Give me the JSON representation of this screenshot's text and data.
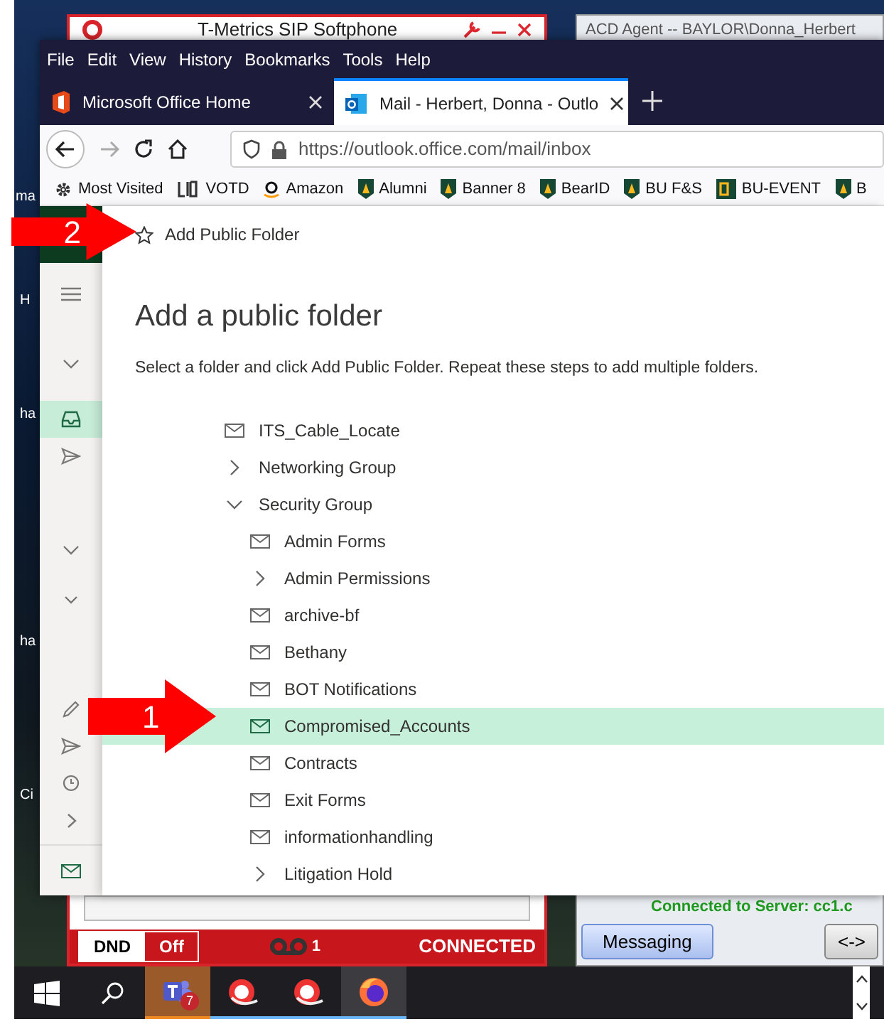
{
  "desktop": {
    "icon_labels": [
      "ma",
      "H",
      "ha",
      "ha",
      "Ci"
    ]
  },
  "softphone": {
    "title": "T-Metrics SIP Softphone",
    "dnd_label": "DND",
    "dnd_value": "Off",
    "dnd_on": false,
    "voicemail_count": "1",
    "status": "CONNECTED"
  },
  "acd_agent": {
    "title": "ACD Agent -- BAYLOR\\Donna_Herbert",
    "server_status": "Connected to Server: cc1.c",
    "buttons": [
      "Messaging",
      "<->"
    ]
  },
  "browser": {
    "menu": [
      "File",
      "Edit",
      "View",
      "History",
      "Bookmarks",
      "Tools",
      "Help"
    ],
    "tabs": [
      {
        "label": "Microsoft Office Home",
        "kind": "office",
        "selected": false
      },
      {
        "label": "Mail - Herbert, Donna - Outlo",
        "kind": "outlook",
        "selected": true
      }
    ],
    "url": "https://outlook.office.com/mail/inbox",
    "bookmarks": [
      {
        "label": "Most Visited",
        "kind": "gear"
      },
      {
        "label": "VOTD",
        "kind": "votd"
      },
      {
        "label": "Amazon",
        "kind": "amazon"
      },
      {
        "label": "Alumni",
        "kind": "bu"
      },
      {
        "label": "Banner 8",
        "kind": "bu"
      },
      {
        "label": "BearID",
        "kind": "bu"
      },
      {
        "label": "BU F&S",
        "kind": "bu"
      },
      {
        "label": "BU-EVENT",
        "kind": "bu-event"
      },
      {
        "label": "B",
        "kind": "bu"
      }
    ]
  },
  "outlook": {
    "rail": [
      [
        {
          "kind": "menu",
          "selected": false
        },
        {
          "kind": "chevron",
          "selected": false
        },
        {
          "kind": "inbox",
          "selected": true
        },
        {
          "kind": "send",
          "selected": false
        }
      ],
      [
        {
          "kind": "chevron",
          "selected": false
        },
        {
          "kind": "chevron-small",
          "selected": false
        }
      ],
      [
        {
          "kind": "pencil",
          "selected": false
        },
        {
          "kind": "send",
          "selected": false
        },
        {
          "kind": "clock",
          "selected": false
        },
        {
          "kind": "chevron-right",
          "selected": false
        },
        {
          "kind": "mail",
          "selected": false
        }
      ]
    ],
    "panel": {
      "header_action": "Add Public Folder",
      "title": "Add a public folder",
      "description": "Select a folder and click Add Public Folder. Repeat these steps to add multiple folders.",
      "folders": [
        {
          "label": "ITS_Cable_Locate",
          "kind": "folder",
          "selected": false
        },
        {
          "label": "Networking Group",
          "kind": "group",
          "expanded": false,
          "selected": false
        },
        {
          "label": "Security Group",
          "kind": "group",
          "expanded": true,
          "selected": false,
          "children": [
            {
              "label": "Admin Forms",
              "kind": "folder",
              "selected": false
            },
            {
              "label": "Admin Permissions",
              "kind": "group",
              "expanded": false,
              "selected": false
            },
            {
              "label": "archive-bf",
              "kind": "folder",
              "selected": false
            },
            {
              "label": "Bethany",
              "kind": "folder",
              "selected": false
            },
            {
              "label": "BOT Notifications",
              "kind": "folder",
              "selected": false
            },
            {
              "label": "Compromised_Accounts",
              "kind": "folder",
              "selected": true
            },
            {
              "label": "Contracts",
              "kind": "folder",
              "selected": false
            },
            {
              "label": "Exit Forms",
              "kind": "folder",
              "selected": false
            },
            {
              "label": "informationhandling",
              "kind": "folder",
              "selected": false
            },
            {
              "label": "Litigation Hold",
              "kind": "group",
              "expanded": false,
              "selected": false
            }
          ]
        }
      ]
    }
  },
  "annotations": [
    {
      "label": "2"
    },
    {
      "label": "1"
    }
  ],
  "taskbar": {
    "apps": [
      {
        "kind": "teams",
        "badge": "7",
        "flashing": true,
        "active": false
      },
      {
        "kind": "softphone",
        "flashing": false,
        "active": false
      },
      {
        "kind": "softphone",
        "flashing": false,
        "active": false
      },
      {
        "kind": "firefox",
        "flashing": false,
        "active": true
      }
    ]
  }
}
